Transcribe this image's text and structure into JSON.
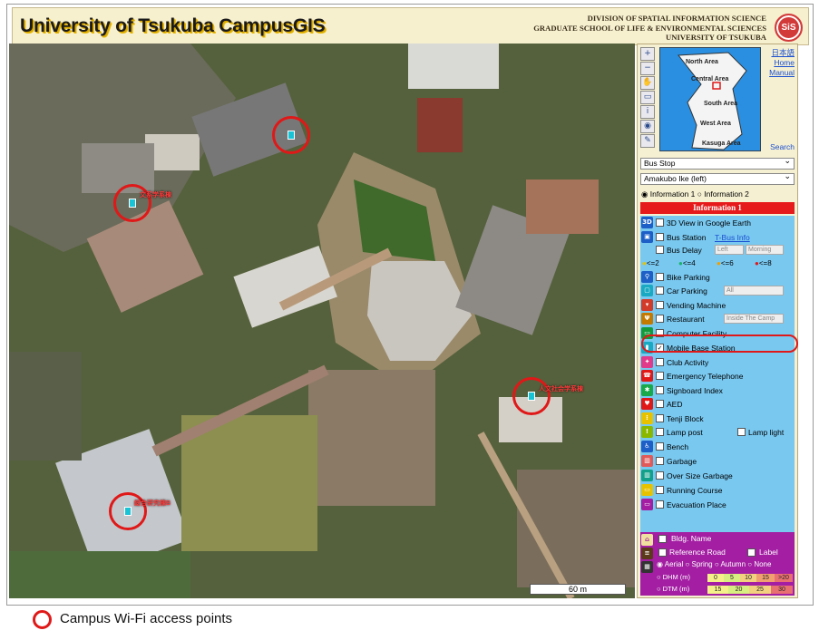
{
  "header": {
    "title": "University of Tsukuba CampusGIS",
    "org_lines": [
      "DIVISION OF SPATIAL INFORMATION SCIENCE",
      "GRADUATE SCHOOL OF LIFE & ENVIRONMENTAL SCIENCES",
      "UNIVERSITY OF TSUKUBA"
    ],
    "logo": "SiS"
  },
  "map": {
    "scale": "60 m",
    "wifi_labels": [
      "",
      "文系学系棟",
      "",
      "人文社会学系棟",
      "総合研究棟B"
    ]
  },
  "panel": {
    "tools": [
      "zoom-in-icon",
      "zoom-out-icon",
      "pan-icon",
      "ruler-icon",
      "info-icon",
      "globe-icon",
      "pencil-icon"
    ],
    "links": {
      "japanese": "日本語",
      "home": "Home",
      "manual": "Manual",
      "search": "Search"
    },
    "minimap_areas": [
      "North Area",
      "Central Area",
      "South Area",
      "West Area",
      "Kasuga Area"
    ],
    "select1": "Bus Stop",
    "select2": "Amakubo Ike (left)",
    "radio1": "Information 1",
    "radio2": "Information 2",
    "info_header": "Information 1",
    "layers": [
      {
        "icon": "3D",
        "label": "3D View in Google Earth",
        "checked": false
      },
      {
        "icon": "bus",
        "label": "Bus Station",
        "link": "T-Bus Info",
        "checked": false
      },
      {
        "icon": "",
        "label": "Bus Delay",
        "checked": false,
        "opt1": "Left",
        "opt2": "Morning"
      },
      {
        "icon": "",
        "label": "",
        "checked": false
      },
      {
        "icon": "bike",
        "label": "Bike Parking",
        "checked": false
      },
      {
        "icon": "car",
        "label": "Car Parking",
        "checked": false,
        "opt1": "All"
      },
      {
        "icon": "cup",
        "label": "Vending Machine",
        "checked": false
      },
      {
        "icon": "fork",
        "label": "Restaurant",
        "checked": false,
        "opt1": "Inside The Camp"
      },
      {
        "icon": "pc",
        "label": "Computer Facility",
        "checked": false
      },
      {
        "icon": "phone",
        "label": "Mobile Base Station",
        "checked": true
      },
      {
        "icon": "run",
        "label": "Club Activity",
        "checked": false
      },
      {
        "icon": "tel",
        "label": "Emergency Telephone",
        "checked": false
      },
      {
        "icon": "sign",
        "label": "Signboard Index",
        "checked": false
      },
      {
        "icon": "aed",
        "label": "AED",
        "checked": false
      },
      {
        "icon": "tenji",
        "label": "Tenji Block",
        "checked": false
      },
      {
        "icon": "lamp",
        "label": "Lamp post",
        "checked": false,
        "extra": "Lamp light"
      },
      {
        "icon": "bench",
        "label": "Bench",
        "checked": false
      },
      {
        "icon": "trash",
        "label": "Garbage",
        "checked": false
      },
      {
        "icon": "trash2",
        "label": "Over Size Garbage",
        "checked": false
      },
      {
        "icon": "course",
        "label": "Running Course",
        "checked": false
      },
      {
        "icon": "evac",
        "label": "Evacuation Place",
        "checked": false
      }
    ],
    "delay_legend": [
      "<=2",
      "<=4",
      "<=6",
      "<=8"
    ],
    "bottom": {
      "bldg": "Bldg. Name",
      "road": "Reference Road",
      "label": "Label",
      "seasons": [
        "Aerial",
        "Spring",
        "Autumn",
        "None"
      ],
      "dhm": "DHM (m)",
      "dtm": "DTM (m)",
      "dhm_scale": [
        "0",
        "5",
        "10",
        "15",
        ">20"
      ],
      "dtm_scale": [
        "15",
        "20",
        "25",
        "30"
      ]
    }
  },
  "legend": {
    "text": "Campus Wi-Fi access points"
  },
  "colors": {
    "accent_red": "#e01818",
    "panel_blue": "#79c8f0",
    "purple": "#a31ea3"
  }
}
